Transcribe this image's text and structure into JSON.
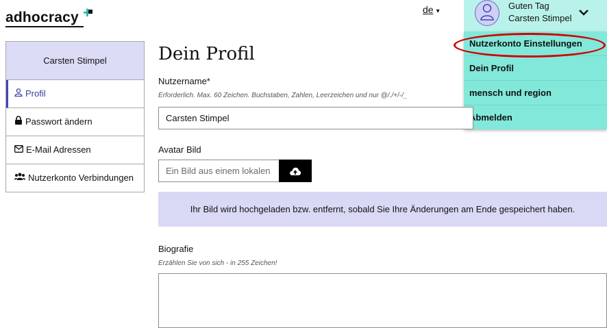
{
  "brand": {
    "logo_text": "adhocracy",
    "plus_symbol": "+"
  },
  "language": {
    "code": "de",
    "caret": "▾"
  },
  "user": {
    "greeting": "Guten Tag",
    "name": "Carsten Stimpel"
  },
  "dropdown": {
    "items": [
      {
        "label": "Nutzerkonto Einstellungen"
      },
      {
        "label": "Dein Profil"
      },
      {
        "label": "mensch und region"
      },
      {
        "label": "Abmelden"
      }
    ]
  },
  "sidebar": {
    "header": "Carsten Stimpel",
    "items": [
      {
        "label": "Profil",
        "icon": "user-icon",
        "active": true
      },
      {
        "label": "Passwort ändern",
        "icon": "lock-icon"
      },
      {
        "label": "E-Mail Adressen",
        "icon": "envelope-icon"
      },
      {
        "label": "Nutzerkonto Verbindungen",
        "icon": "users-icon"
      }
    ]
  },
  "main": {
    "title": "Dein Profil",
    "username": {
      "label": "Nutzername*",
      "hint": "Erforderlich. Max. 60 Zeichen. Buchstaben, Zahlen, Leerzeichen und nur @/./+/-/_",
      "value": "Carsten Stimpel"
    },
    "avatar": {
      "label": "Avatar Bild",
      "placeholder": "Ein Bild aus einem lokalen"
    },
    "notice": "Ihr Bild wird hochgeladen bzw. entfernt, sobald Sie Ihre Änderungen am Ende gespeichert haben.",
    "biography": {
      "label": "Biografie",
      "hint": "Erzählen Sie von sich - in 255 Zeichen!"
    }
  },
  "colors": {
    "accent": "#4544b8",
    "dropdown_bg": "#82e8da",
    "user_bg": "#b9f2ea",
    "notice_bg": "#d9d9f5",
    "highlight": "#d10000"
  }
}
